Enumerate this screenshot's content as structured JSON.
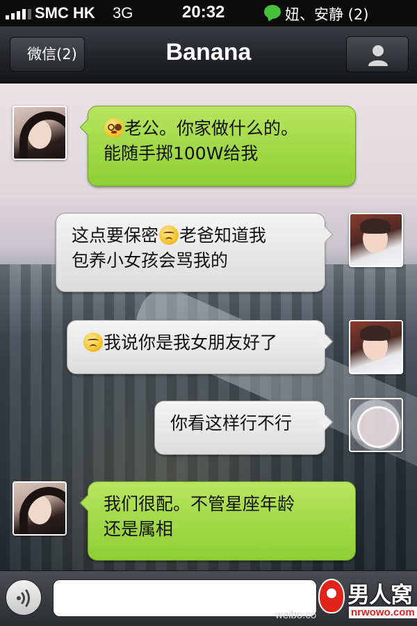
{
  "status_bar": {
    "carrier": "SMC HK",
    "network": "3G",
    "time": "20:32",
    "notification_icon": "wechat-bubble-icon",
    "notification_text": "妞、安静 (2)"
  },
  "nav_bar": {
    "back_label": "微信(2)",
    "title": "Banana",
    "profile_icon": "person-icon"
  },
  "messages": [
    {
      "side": "left",
      "avatar": "girl",
      "emoji_before": "flushed-emoji",
      "line1": "老公。你家做什么的。",
      "line2": "能随手掷100W给我"
    },
    {
      "side": "right",
      "avatar": "boy",
      "line1_a": "这点要保密",
      "emoji_mid": "sad-emoji",
      "line1_b": "老爸知道我",
      "line2": "包养小女孩会骂我的"
    },
    {
      "side": "right",
      "avatar": "boy",
      "emoji_before": "sad-emoji",
      "line1": "我说你是我女朋友好了"
    },
    {
      "side": "right",
      "avatar": "voice",
      "line1": "你看这样行不行"
    },
    {
      "side": "left",
      "avatar": "girl",
      "line1": "我们很配。不管星座年龄",
      "line2": "还是属相"
    }
  ],
  "input_bar": {
    "voice_icon": "voice-wave-icon",
    "placeholder": ""
  },
  "watermark": {
    "site_name": "男人窝",
    "site_url": "nrwowo.com",
    "weibo": "weibo.co"
  },
  "colors": {
    "green_bubble": "#9fd845",
    "grey_bubble": "#e8e8e8",
    "navbar": "#26282c"
  }
}
